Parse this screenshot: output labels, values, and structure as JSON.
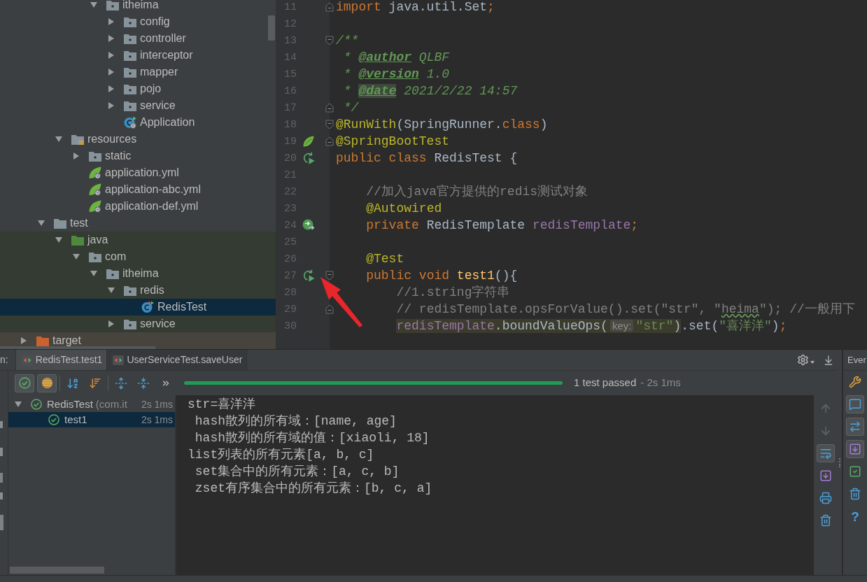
{
  "project_tree": {
    "items": [
      {
        "children": [
          {
            "children": [
              {
                "children": [
                  {
                    "children": [
                      {
                        "label": "itheima",
                        "kind": "package",
                        "expanded": true,
                        "selected": false,
                        "children": [
                          {
                            "label": "config",
                            "kind": "package",
                            "expanded": false,
                            "selected": false
                          },
                          {
                            "label": "controller",
                            "kind": "package",
                            "expanded": false,
                            "selected": false
                          },
                          {
                            "label": "interceptor",
                            "kind": "package",
                            "expanded": false,
                            "selected": false
                          },
                          {
                            "label": "mapper",
                            "kind": "package",
                            "expanded": false,
                            "selected": false
                          },
                          {
                            "label": "pojo",
                            "kind": "package",
                            "expanded": false,
                            "selected": false
                          },
                          {
                            "label": "service",
                            "kind": "package",
                            "expanded": false,
                            "selected": false
                          },
                          {
                            "label": "Application",
                            "kind": "spring-class",
                            "selected": false
                          }
                        ]
                      }
                    ]
                  }
                ]
              },
              {
                "label": "resources",
                "kind": "resources-root",
                "expanded": true,
                "selected": false,
                "children": [
                  {
                    "label": "static",
                    "kind": "package",
                    "expanded": false,
                    "selected": false
                  },
                  {
                    "label": "application.yml",
                    "kind": "spring-config",
                    "selected": false
                  },
                  {
                    "label": "application-abc.yml",
                    "kind": "spring-config",
                    "selected": false
                  },
                  {
                    "label": "application-def.yml",
                    "kind": "spring-config",
                    "selected": false
                  }
                ]
              }
            ]
          },
          {
            "label": "test",
            "kind": "folder",
            "expanded": true,
            "selected": false,
            "children": [
              {
                "label": "java",
                "kind": "test-root",
                "expanded": true,
                "selected": false,
                "children": [
                  {
                    "label": "com",
                    "kind": "package",
                    "expanded": true,
                    "selected": false,
                    "children": [
                      {
                        "label": "itheima",
                        "kind": "package",
                        "expanded": true,
                        "selected": false,
                        "children": [
                          {
                            "label": "redis",
                            "kind": "package",
                            "expanded": true,
                            "selected": false,
                            "children": [
                              {
                                "label": "RedisTest",
                                "kind": "test-class",
                                "selected": true
                              }
                            ]
                          },
                          {
                            "label": "service",
                            "kind": "package",
                            "expanded": false,
                            "selected": false
                          }
                        ]
                      }
                    ]
                  }
                ]
              }
            ]
          }
        ]
      },
      {
        "label": "target",
        "kind": "excluded-root",
        "expanded": false,
        "selected": false
      }
    ]
  },
  "editor": {
    "lines": [
      {
        "number": "11",
        "fold_marker": {
          "kind": "end"
        },
        "tokens": [
          {
            "text": "import",
            "kind": "keyword"
          },
          {
            "text": " java.util.Set",
            "kind": "plain"
          },
          {
            "text": ";",
            "kind": "keyword"
          }
        ]
      },
      {
        "number": "12"
      },
      {
        "number": "13",
        "fold_marker": {
          "kind": "start"
        },
        "tokens": [
          {
            "text": "/**",
            "kind": "doc"
          }
        ]
      },
      {
        "number": "14",
        "tokens": [
          {
            "text": " * ",
            "kind": "doc"
          },
          {
            "text": "@author",
            "kind": "doc-tag"
          },
          {
            "text": " QLBF",
            "kind": "doc"
          }
        ]
      },
      {
        "number": "15",
        "tokens": [
          {
            "text": " * ",
            "kind": "doc"
          },
          {
            "text": "@version",
            "kind": "doc-tag"
          },
          {
            "text": " 1.0",
            "kind": "doc"
          }
        ]
      },
      {
        "number": "16",
        "tokens": [
          {
            "text": " * ",
            "kind": "doc"
          },
          {
            "text": "@date",
            "kind": "doc-tag-hl"
          },
          {
            "text": " 2021/2/22 14:57",
            "kind": "doc"
          }
        ]
      },
      {
        "number": "17",
        "fold_marker": {
          "kind": "end"
        },
        "tokens": [
          {
            "text": " */",
            "kind": "doc"
          }
        ]
      },
      {
        "number": "18",
        "fold_marker": {
          "kind": "start"
        },
        "tokens": [
          {
            "text": "@RunWith",
            "kind": "annotation"
          },
          {
            "text": "(SpringRunner.",
            "kind": "plain"
          },
          {
            "text": "class",
            "kind": "keyword"
          },
          {
            "text": ")",
            "kind": "plain"
          }
        ]
      },
      {
        "number": "19",
        "fold_marker": {
          "kind": "end"
        },
        "gutter_icon": {
          "kind": "leaf"
        },
        "tokens": [
          {
            "text": "@SpringBootTest",
            "kind": "annotation"
          }
        ]
      },
      {
        "number": "20",
        "gutter_icon": {
          "kind": "run"
        },
        "tokens": [
          {
            "text": "public class",
            "kind": "keyword"
          },
          {
            "text": " RedisTest {",
            "kind": "plain"
          }
        ]
      },
      {
        "number": "21"
      },
      {
        "number": "22",
        "tokens": [
          {
            "text": "    //加入java官方提供的redis测试对象",
            "kind": "comment"
          }
        ]
      },
      {
        "number": "23",
        "tokens": [
          {
            "text": "    @Autowired",
            "kind": "annotation"
          }
        ]
      },
      {
        "number": "24",
        "gutter_icon": {
          "kind": "autowired"
        },
        "tokens": [
          {
            "text": "    private",
            "kind": "keyword"
          },
          {
            "text": " RedisTemplate ",
            "kind": "plain"
          },
          {
            "text": "redisTemplate",
            "kind": "field"
          },
          {
            "text": ";",
            "kind": "keyword"
          }
        ]
      },
      {
        "number": "25"
      },
      {
        "number": "26",
        "tokens": [
          {
            "text": "    @Test",
            "kind": "annotation"
          }
        ]
      },
      {
        "number": "27",
        "fold_marker": {
          "kind": "start"
        },
        "gutter_icon": {
          "kind": "run"
        },
        "tokens": [
          {
            "text": "    public void ",
            "kind": "keyword"
          },
          {
            "text": "test1",
            "kind": "method"
          },
          {
            "text": "(){",
            "kind": "plain"
          }
        ]
      },
      {
        "number": "28",
        "tokens": [
          {
            "text": "        //1.string字符串",
            "kind": "comment"
          }
        ]
      },
      {
        "number": "29",
        "fold_marker": {
          "kind": "end"
        },
        "tokens": [
          {
            "text": "        // redisTemplate.opsForValue().set(\"str\", \"",
            "kind": "comment"
          },
          {
            "text": "heima",
            "kind": "comment-typo"
          },
          {
            "text": "\"); //一般用下",
            "kind": "comment"
          }
        ]
      },
      {
        "number": "30",
        "tokens": [
          {
            "text": "        redisTemplate",
            "kind": "field-hl"
          },
          {
            "text": ".boundValueOps(",
            "kind": "plain-hl"
          },
          {
            "text": "key:",
            "kind": "hint"
          },
          {
            "text": "\"str\"",
            "kind": "string-hl"
          },
          {
            "text": ")",
            "kind": "plain-hl"
          },
          {
            "text": ".set(",
            "kind": "plain"
          },
          {
            "text": "\"喜洋洋\"",
            "kind": "string"
          },
          {
            "text": ")",
            "kind": "plain"
          },
          {
            "text": ";",
            "kind": "keyword"
          }
        ]
      }
    ]
  },
  "run_tabs": {
    "prefix": "n:",
    "tabs": [
      {
        "label": "RedisTest.test1",
        "selected": true
      },
      {
        "label": "UserServiceTest.saveUser",
        "selected": false
      }
    ]
  },
  "test_toolbar": {
    "buttons": [
      {
        "kind": "show-passed",
        "on": true
      },
      {
        "kind": "show-ignored",
        "on": true
      },
      {
        "kind": "sort-alpha",
        "on": false
      },
      {
        "kind": "sort-duration",
        "on": false
      },
      {
        "kind": "expand-all",
        "on": false
      },
      {
        "kind": "collapse-all",
        "on": false
      },
      {
        "kind": "more",
        "on": false
      }
    ],
    "progress": {
      "level": 1
    },
    "summary": "1 test passed",
    "duration": "- 2s 1ms"
  },
  "test_tree": {
    "items": [
      {
        "label": "RedisTest",
        "package": "(com.it",
        "time": "2s 1ms",
        "kind": "passed",
        "expanded": true,
        "selected": false,
        "children": [
          {
            "label": "test1",
            "time": "2s 1ms",
            "kind": "passed",
            "selected": true
          }
        ]
      }
    ]
  },
  "console": {
    "lines": [
      "str=喜洋洋",
      " hash散列的所有域：[name, age]",
      " hash散列的所有域的值：[xiaoli, 18]",
      "list列表的所有元素[a, b, c]",
      " set集合中的所有元素：[a, c, b]",
      " zset有序集合中的所有元素：[b, c, a]"
    ]
  },
  "console_toolbar": [
    {
      "kind": "up",
      "on": false,
      "disabled": true
    },
    {
      "kind": "down",
      "on": false,
      "disabled": true
    },
    {
      "kind": "soft-wrap",
      "on": true,
      "disabled": false
    },
    {
      "kind": "scroll-end",
      "on": false,
      "disabled": false
    },
    {
      "kind": "print",
      "on": false,
      "disabled": false
    },
    {
      "kind": "clear",
      "on": false,
      "disabled": false
    }
  ],
  "event_log": {
    "title": "Ever",
    "toolbar": [
      {
        "kind": "settings",
        "on": false
      },
      {
        "kind": "bubble",
        "on": true
      },
      {
        "kind": "swap",
        "on": true
      },
      {
        "kind": "scroll-end",
        "on": true
      },
      {
        "kind": "checkbox",
        "on": false
      },
      {
        "kind": "clear",
        "on": false
      },
      {
        "kind": "help",
        "label": "?",
        "on": false
      }
    ]
  }
}
